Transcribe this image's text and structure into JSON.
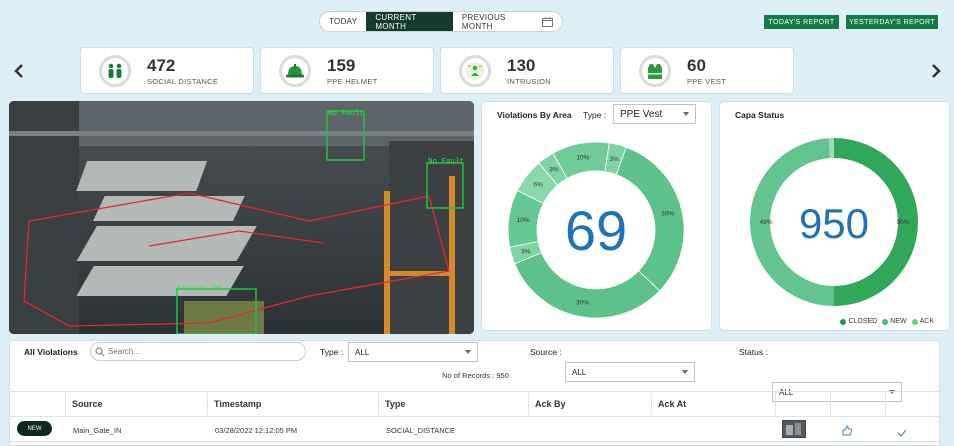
{
  "range_tabs": [
    {
      "label": "TODAY"
    },
    {
      "label": "CURRENT MONTH"
    },
    {
      "label": "PREVIOUS MONTH"
    }
  ],
  "reports": {
    "today": "TODAY'S REPORT",
    "yesterday": "YESTERDAY'S REPORT"
  },
  "cards": [
    {
      "value": "472",
      "label": "SOCIAL DISTANCE",
      "icon": "social-distance-icon"
    },
    {
      "value": "159",
      "label": "PPE HELMET",
      "icon": "helmet-icon"
    },
    {
      "value": "130",
      "label": "INTRUSION",
      "icon": "intrusion-icon"
    },
    {
      "value": "60",
      "label": "PPE VEST",
      "icon": "vest-icon"
    }
  ],
  "camera": {
    "boxes": [
      {
        "label": "No Fault"
      },
      {
        "label": "No Fault"
      },
      {
        "label": "Status: OK"
      }
    ]
  },
  "violations_by_area": {
    "title": "Violations By Area",
    "type_label": "Type :",
    "type_value": "PPE Vest",
    "center": "69",
    "slices": [
      {
        "label": "30%",
        "value": 30
      },
      {
        "label": "30%",
        "value": 30
      },
      {
        "label": "3%",
        "value": 3
      },
      {
        "label": "10%",
        "value": 10
      },
      {
        "label": "6%",
        "value": 6
      },
      {
        "label": "3%",
        "value": 3
      },
      {
        "label": "10%",
        "value": 10
      },
      {
        "label": "3%",
        "value": 3
      }
    ],
    "colors": [
      "#5cc28a",
      "#5cc28a",
      "#7ed3a2",
      "#64c892",
      "#88d8aa",
      "#7ed3a2",
      "#6fcc98",
      "#7ed3a2"
    ]
  },
  "capa_status": {
    "title": "Capa Status",
    "center": "950",
    "slices": [
      {
        "label": "50%",
        "value": 50,
        "color": "#2fa85a"
      },
      {
        "label": "49%",
        "value": 49,
        "color": "#63c48f"
      },
      {
        "label": "",
        "value": 1,
        "color": "#9fdcb6"
      }
    ],
    "legend": [
      {
        "label": "CLOSED",
        "color": "#22954a"
      },
      {
        "label": "NEW",
        "color": "#49b878"
      },
      {
        "label": "ACK",
        "color": "#6cc98d"
      }
    ]
  },
  "table": {
    "title": "All Violations",
    "search_placeholder": "Search...",
    "filters": [
      {
        "label": "Type :",
        "value": "ALL"
      },
      {
        "label": "Source :",
        "value": "ALL"
      },
      {
        "label": "Status :",
        "value": "ALL"
      }
    ],
    "records": "No of Records : 950",
    "headers": [
      "Source",
      "Timestamp",
      "Type",
      "Ack By",
      "Ack At"
    ],
    "rows": [
      {
        "status": "NEW",
        "source": "Main_Gate_IN",
        "timestamp": "03/28/2022 12:12:05 PM",
        "type": "SOCIAL_DISTANCE",
        "ack_by": "",
        "ack_at": ""
      }
    ]
  }
}
